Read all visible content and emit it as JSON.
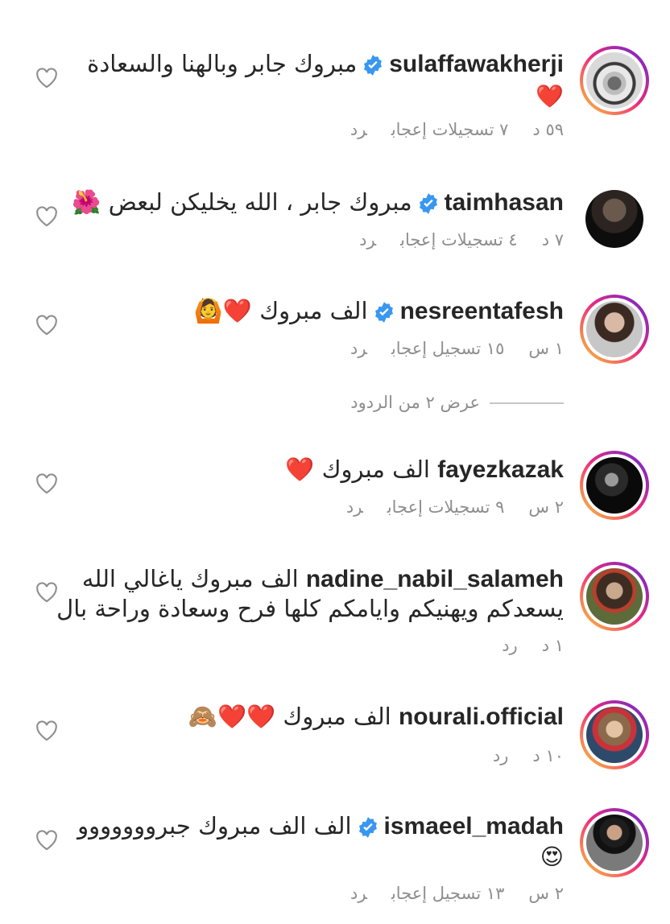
{
  "accent_verified": "#3897f0",
  "heart_emoji_color": "#ed3446",
  "comments": [
    {
      "username": "sulaffawakherji",
      "verified": true,
      "text_line1": "مبروك جابر وبالهنا والسعادة",
      "text_line2": "❤️",
      "time": "٥٩ د",
      "likes": "٧ تسجيلات إعجاب",
      "reply": "رد",
      "avatar_ring": true
    },
    {
      "username": "taimhasan",
      "verified": true,
      "text_line1": "مبروك جابر ، الله يخليكن لبعض 🌺",
      "time": "٧ د",
      "likes": "٤ تسجيلات إعجاب",
      "reply": "رد",
      "avatar_ring": false
    },
    {
      "username": "nesreentafesh",
      "verified": true,
      "text_line1": "الف مبروك ❤️🙆",
      "time": "١ س",
      "likes": "١٥ تسجيل إعجاب",
      "reply": "رد",
      "avatar_ring": true
    },
    {
      "username": "fayezkazak",
      "verified": false,
      "text_line1": "الف مبروك ❤️",
      "time": "٢ س",
      "likes": "٩ تسجيلات إعجاب",
      "reply": "رد",
      "avatar_ring": true
    },
    {
      "username": "nadine_nabil_salameh",
      "verified": false,
      "text_line1": "الف مبروك ياغالي الله",
      "text_line2": "يسعدكم ويهنيكم وايامكم كلها فرح وسعادة وراحة بال",
      "time": "١ د",
      "reply": "رد",
      "avatar_ring": true
    },
    {
      "username": "nourali.official",
      "verified": false,
      "text_line1": "الف مبروك ❤️❤️🙈",
      "time": "١٠ د",
      "reply": "رد",
      "avatar_ring": true
    },
    {
      "username": "ismaeel_madah",
      "verified": true,
      "text_line1": "الف الف مبروك جبرووووووو",
      "text_line2": "😍",
      "time": "٢ س",
      "likes": "١٣ تسجيل إعجاب",
      "reply": "رد",
      "avatar_ring": true
    }
  ],
  "view_replies": "عرض ٢ من الردود"
}
